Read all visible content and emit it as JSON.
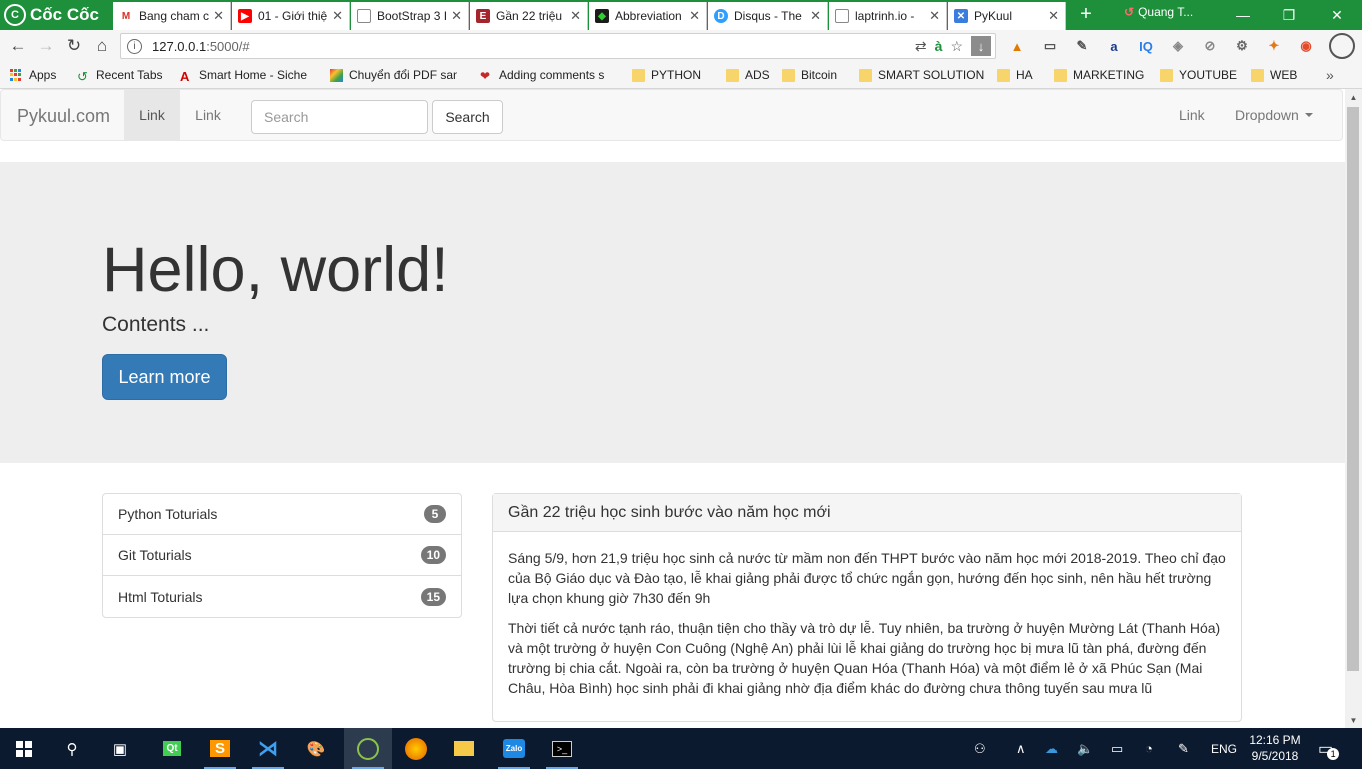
{
  "browser": {
    "brand": "Cốc Cốc",
    "tabs": [
      {
        "title": "Bang cham c",
        "icon": "gmail-icon",
        "color": "#d93025"
      },
      {
        "title": "01 - Giới thiệ",
        "icon": "youtube-icon",
        "color": "#ff0000"
      },
      {
        "title": "BootStrap 3 I",
        "icon": "page-icon",
        "color": "#888888"
      },
      {
        "title": "Gần 22 triệu I",
        "icon": "news-icon",
        "color": "#a4262c"
      },
      {
        "title": "Abbreviation",
        "icon": "abbr-icon",
        "color": "#1b1b1b"
      },
      {
        "title": "Disqus - The",
        "icon": "disqus-icon",
        "color": "#2e9fff"
      },
      {
        "title": "laptrinh.io -",
        "icon": "page-icon",
        "color": "#888888"
      },
      {
        "title": "PyKuul",
        "icon": "pykuul-icon",
        "color": "#3b7ddd"
      }
    ],
    "user_name": "Quang T...",
    "address": {
      "host": "127.0.0.1",
      "rest": ":5000/#"
    },
    "bookmarks": [
      {
        "label": "Apps",
        "type": "apps"
      },
      {
        "label": "Recent Tabs",
        "type": "recent"
      },
      {
        "label": "Smart Home - Siche",
        "type": "site"
      },
      {
        "label": "Chuyển đổi PDF sang",
        "type": "site"
      },
      {
        "label": "Adding comments s",
        "type": "site"
      },
      {
        "label": "PYTHON",
        "type": "folder"
      },
      {
        "label": "ADS",
        "type": "folder"
      },
      {
        "label": "Bitcoin",
        "type": "folder"
      },
      {
        "label": "SMART SOLUTION",
        "type": "folder"
      },
      {
        "label": "HA",
        "type": "folder"
      },
      {
        "label": "MARKETING",
        "type": "folder"
      },
      {
        "label": "YOUTUBE",
        "type": "folder"
      },
      {
        "label": "WEB",
        "type": "folder"
      }
    ]
  },
  "navbar": {
    "brand": "Pykuul.com",
    "links": [
      "Link",
      "Link"
    ],
    "search_placeholder": "Search",
    "search_button": "Search",
    "right_link": "Link",
    "dropdown": "Dropdown"
  },
  "jumbotron": {
    "heading": "Hello, world!",
    "text": "Contents ...",
    "button": "Learn more"
  },
  "list": [
    {
      "label": "Python Toturials",
      "count": "5"
    },
    {
      "label": "Git Toturials",
      "count": "10"
    },
    {
      "label": "Html Toturials",
      "count": "15"
    }
  ],
  "panel": {
    "heading": "Gần 22 triệu học sinh bước vào năm học mới",
    "paragraphs": [
      "Sáng 5/9, hơn 21,9 triệu học sinh cả nước từ mầm non đến THPT bước vào năm học mới 2018-2019. Theo chỉ đạo của Bộ Giáo dục và Đào tạo, lễ khai giảng phải được tổ chức ngắn gọn, hướng đến học sinh, nên hầu hết trường lựa chọn khung giờ 7h30 đến 9h",
      "Thời tiết cả nước tạnh ráo, thuận tiện cho thầy và trò dự lễ. Tuy nhiên, ba trường ở huyện Mường Lát (Thanh Hóa) và một trường ở huyện Con Cuông (Nghệ An) phải lùi lễ khai giảng do trường học bị mưa lũ tàn phá, đường đến trường bị chia cắt. Ngoài ra, còn ba trường ở huyện Quan Hóa (Thanh Hóa) và một điểm lẻ ở xã Phúc Sạn (Mai Châu, Hòa Bình) học sinh phải đi khai giảng nhờ địa điểm khác do đường chưa thông tuyến sau mưa lũ"
    ]
  },
  "taskbar": {
    "language": "ENG",
    "time": "12:16 PM",
    "date": "9/5/2018",
    "notification_count": "1"
  }
}
